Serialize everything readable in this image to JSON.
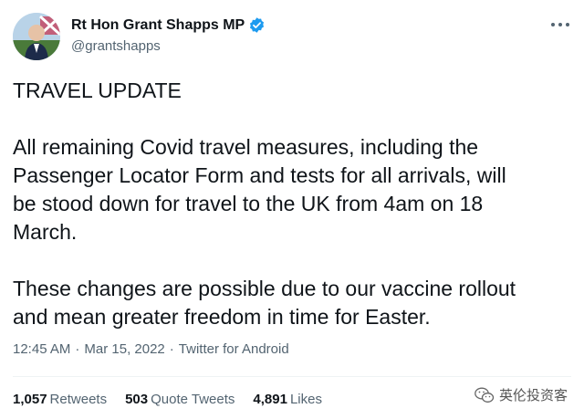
{
  "author": {
    "display_name": "Rt Hon Grant Shapps MP",
    "handle": "@grantshapps",
    "avatar_icon": "profile-photo",
    "verified_icon": "verified-badge-icon",
    "verified_color": "#1d9bf0"
  },
  "tweet": {
    "heading": "TRAVEL UPDATE",
    "paragraph1_lines": [
      "All remaining Covid travel measures, including the",
      "Passenger Locator Form and tests for all arrivals, will",
      "be stood down for travel to the UK from 4am on 18",
      "March."
    ],
    "paragraph2_lines": [
      "These changes are possible due to our vaccine rollout",
      "and mean greater freedom in time for Easter."
    ]
  },
  "meta": {
    "time": "12:45 AM",
    "date": "Mar 15, 2022",
    "source": "Twitter for Android",
    "separator": "·"
  },
  "stats": {
    "retweets_count": "1,057",
    "retweets_label": "Retweets",
    "quotes_count": "503",
    "quotes_label": "Quote Tweets",
    "likes_count": "4,891",
    "likes_label": "Likes"
  },
  "watermark": {
    "text": "英伦投资客",
    "icon": "wechat-icon"
  }
}
